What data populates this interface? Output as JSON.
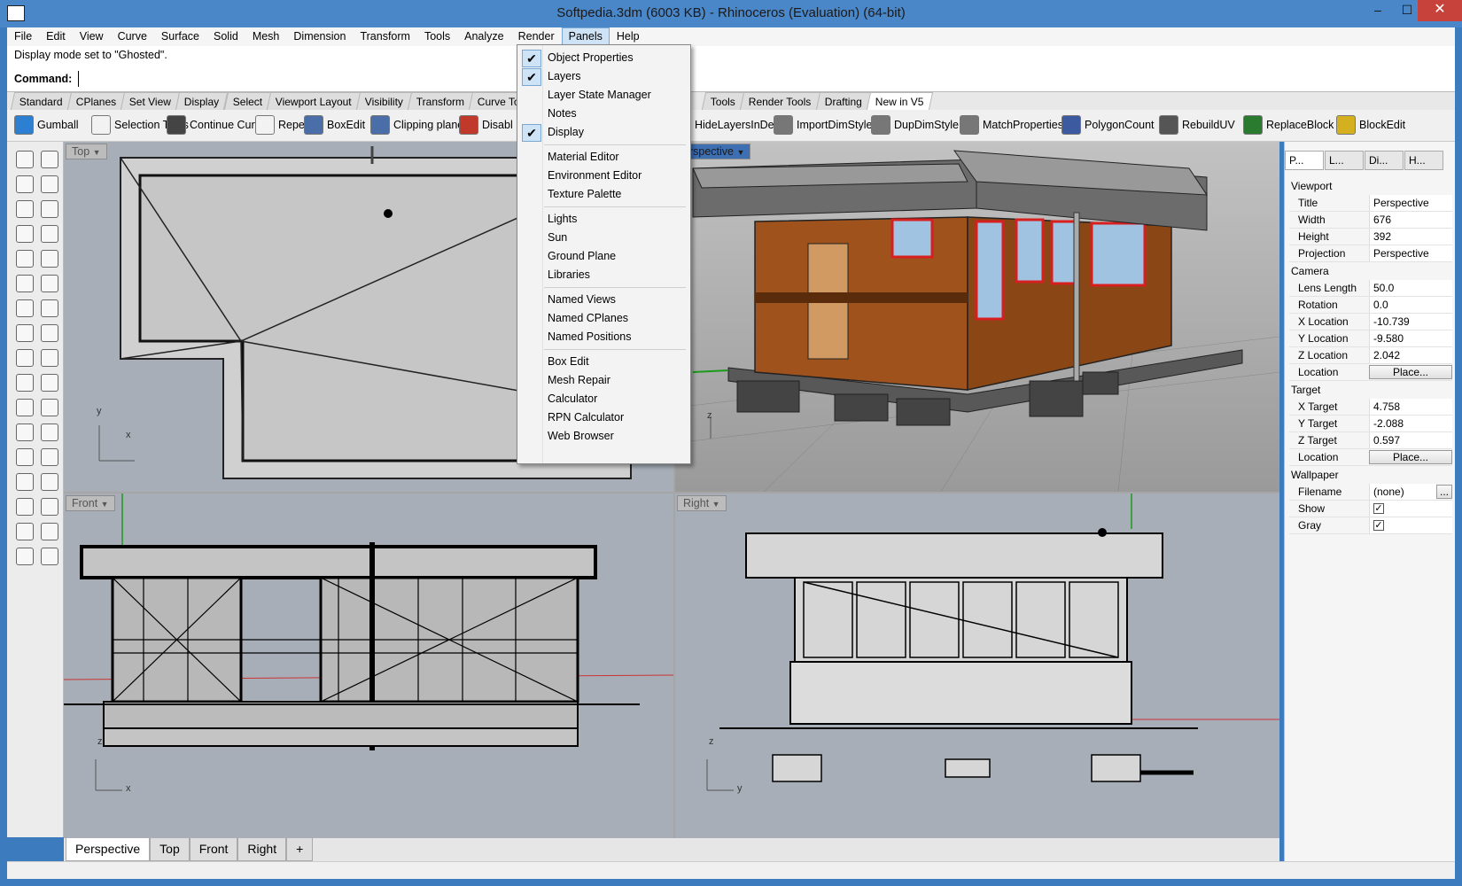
{
  "window": {
    "title": "Softpedia.3dm (6003 KB) - Rhinoceros (Evaluation) (64-bit)",
    "minimize": "–",
    "maximize": "☐",
    "close": "✕"
  },
  "menu": [
    "File",
    "Edit",
    "View",
    "Curve",
    "Surface",
    "Solid",
    "Mesh",
    "Dimension",
    "Transform",
    "Tools",
    "Analyze",
    "Render",
    "Panels",
    "Help"
  ],
  "command": {
    "history": "Display mode set to \"Ghosted\".",
    "prompt": "Command:"
  },
  "toolbar_tabs": [
    "Standard",
    "CPlanes",
    "Set View",
    "Display",
    "Select",
    "Viewport Layout",
    "Visibility",
    "Transform",
    "Curve Tools",
    "Tools",
    "Render Tools",
    "Drafting",
    "New in V5"
  ],
  "toolbar": [
    {
      "label": "Gumball",
      "color": "#2d7fd1"
    },
    {
      "label": "Selection Tools",
      "color": "#f2f2f2"
    },
    {
      "label": "Continue Curve",
      "color": "#444444"
    },
    {
      "label": "Repeat",
      "color": "#f2f2f2"
    },
    {
      "label": "BoxEdit",
      "color": "#4a6ea8"
    },
    {
      "label": "Clipping plane",
      "color": "#4a6ea8"
    },
    {
      "label": "Disabl",
      "color": "#c0392b"
    },
    {
      "label": "HideLayersInDetail",
      "color": "#c0392b"
    },
    {
      "label": "ImportDimStyle",
      "color": "#777777"
    },
    {
      "label": "DupDimStyle",
      "color": "#777777"
    },
    {
      "label": "MatchProperties",
      "color": "#777777"
    },
    {
      "label": "PolygonCount",
      "color": "#3c5aa0"
    },
    {
      "label": "RebuildUV",
      "color": "#555555"
    },
    {
      "label": "ReplaceBlock",
      "color": "#2a7a30"
    },
    {
      "label": "BlockEdit",
      "color": "#d4b020"
    }
  ],
  "panels_menu": {
    "groups": [
      [
        {
          "label": "Object Properties",
          "checked": true
        },
        {
          "label": "Layers",
          "checked": true
        },
        {
          "label": "Layer State Manager",
          "checked": false
        },
        {
          "label": "Notes",
          "checked": false
        },
        {
          "label": "Display",
          "checked": true
        }
      ],
      [
        {
          "label": "Material Editor",
          "checked": false
        },
        {
          "label": "Environment Editor",
          "checked": false
        },
        {
          "label": "Texture Palette",
          "checked": false
        }
      ],
      [
        {
          "label": "Lights",
          "checked": false
        },
        {
          "label": "Sun",
          "checked": false
        },
        {
          "label": "Ground Plane",
          "checked": false
        },
        {
          "label": "Libraries",
          "checked": false
        }
      ],
      [
        {
          "label": "Named Views",
          "checked": false
        },
        {
          "label": "Named CPlanes",
          "checked": false
        },
        {
          "label": "Named Positions",
          "checked": false
        }
      ],
      [
        {
          "label": "Box Edit",
          "checked": false
        },
        {
          "label": "Mesh Repair",
          "checked": false
        },
        {
          "label": "Calculator",
          "checked": false
        },
        {
          "label": "RPN Calculator",
          "checked": false
        },
        {
          "label": "Web Browser",
          "checked": false
        }
      ]
    ],
    "check_glyph": "✔"
  },
  "viewports": {
    "top": "Top",
    "perspective": "erspective",
    "front": "Front",
    "right": "Right",
    "arrow": "▼"
  },
  "axes": {
    "x": "x",
    "y": "y",
    "z": "z"
  },
  "bottom_tabs": [
    "Perspective",
    "Top",
    "Front",
    "Right",
    "+"
  ],
  "panel_tabs": [
    "P...",
    "L...",
    "Di...",
    "H..."
  ],
  "properties": {
    "viewport_section": "Viewport",
    "title_k": "Title",
    "title_v": "Perspective",
    "width_k": "Width",
    "width_v": "676",
    "height_k": "Height",
    "height_v": "392",
    "projection_k": "Projection",
    "projection_v": "Perspective",
    "camera_section": "Camera",
    "lens_k": "Lens Length",
    "lens_v": "50.0",
    "rotation_k": "Rotation",
    "rotation_v": "0.0",
    "xloc_k": "X Location",
    "xloc_v": "-10.739",
    "yloc_k": "Y Location",
    "yloc_v": "-9.580",
    "zloc_k": "Z Location",
    "zloc_v": "2.042",
    "loc_k": "Location",
    "loc_btn": "Place...",
    "target_section": "Target",
    "xt_k": "X Target",
    "xt_v": "4.758",
    "yt_k": "Y Target",
    "yt_v": "-2.088",
    "zt_k": "Z Target",
    "zt_v": "0.597",
    "tloc_k": "Location",
    "tloc_btn": "Place...",
    "wallpaper_section": "Wallpaper",
    "file_k": "Filename",
    "file_v": "(none)",
    "file_btn": "...",
    "show_k": "Show",
    "show_v": "✓",
    "gray_k": "Gray",
    "gray_v": "✓"
  }
}
